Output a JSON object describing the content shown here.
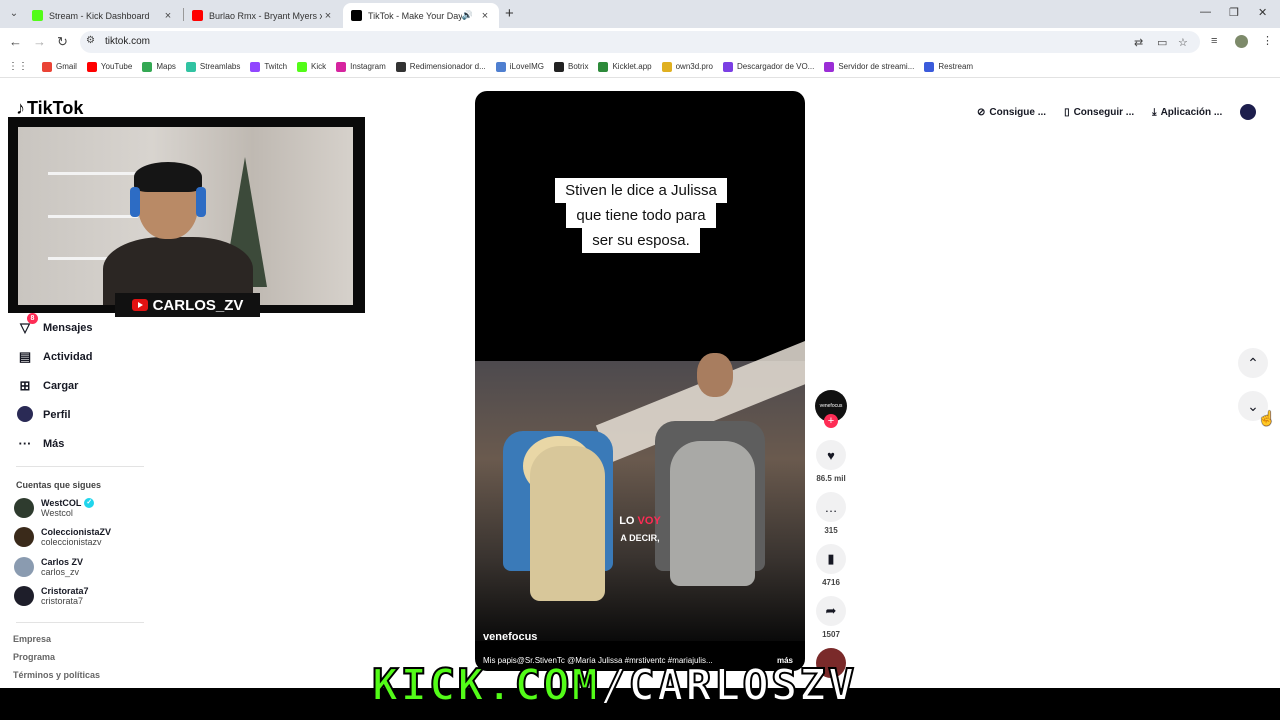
{
  "browser": {
    "tabs": [
      {
        "title": "Stream - Kick Dashboard",
        "color": "#53fc18"
      },
      {
        "title": "Burlao Rmx - Bryant Myers x An",
        "color": "#ff0000"
      },
      {
        "title": "TikTok - Make Your Day",
        "color": "#000000"
      }
    ],
    "url": "tiktok.com",
    "bookmarks": [
      {
        "label": "Gmail",
        "color": "#ea4335"
      },
      {
        "label": "YouTube",
        "color": "#ff0000"
      },
      {
        "label": "Maps",
        "color": "#34a853"
      },
      {
        "label": "Streamlabs",
        "color": "#31c3a2"
      },
      {
        "label": "Twitch",
        "color": "#9146ff"
      },
      {
        "label": "Kick",
        "color": "#53fc18"
      },
      {
        "label": "Instagram",
        "color": "#d6249f"
      },
      {
        "label": "Redimensionador d...",
        "color": "#333333"
      },
      {
        "label": "iLoveIMG",
        "color": "#4f7fd0"
      },
      {
        "label": "Botrix",
        "color": "#222222"
      },
      {
        "label": "Kicklet.app",
        "color": "#2d8a3a"
      },
      {
        "label": "own3d.pro",
        "color": "#e0b020"
      },
      {
        "label": "Descargador de VO...",
        "color": "#7b3fe4"
      },
      {
        "label": "Servidor de streami...",
        "color": "#9b2dd6"
      },
      {
        "label": "Restream",
        "color": "#3b5bdb"
      }
    ]
  },
  "tiktok": {
    "logo": "TikTok",
    "nav": [
      {
        "label": "Mensajes",
        "icon": "send-icon",
        "badge": "8"
      },
      {
        "label": "Actividad",
        "icon": "activity-icon"
      },
      {
        "label": "Cargar",
        "icon": "upload-icon"
      },
      {
        "label": "Perfil",
        "icon": "profile-avatar"
      },
      {
        "label": "Más",
        "icon": "more-icon"
      }
    ],
    "following_title": "Cuentas que sigues",
    "following": [
      {
        "name": "WestCOL",
        "user": "Westcol",
        "verified": true,
        "color": "#2e3b2e"
      },
      {
        "name": "ColeccionistaZV",
        "user": "coleccionistazv",
        "verified": false,
        "color": "#3a2a1a"
      },
      {
        "name": "Carlos ZV",
        "user": "carlos_zv",
        "verified": false,
        "color": "#8a9bb0"
      },
      {
        "name": "Cristorata7",
        "user": "cristorata7",
        "verified": false,
        "color": "#1e1e2a"
      }
    ],
    "footer": [
      "Empresa",
      "Programa",
      "Términos y políticas"
    ],
    "topright": [
      {
        "label": "Consigue ...",
        "icon": "coin-icon"
      },
      {
        "label": "Conseguir ...",
        "icon": "phone-icon"
      },
      {
        "label": "Aplicación ...",
        "icon": "download-icon"
      }
    ],
    "video": {
      "caption": [
        "Stiven le dice a Julissa",
        "que tiene todo para",
        "ser su esposa."
      ],
      "subtitle_a": "LO",
      "subtitle_b": "VOY",
      "subtitle_line2": "A DECIR,",
      "author": "venefocus",
      "description": "Mis papis@Sr.StivenTc @María Julissa #mrstiventc #mariajulis...",
      "more": "más"
    },
    "actions": {
      "author_avatar": "venefocus",
      "likes": "86.5 mil",
      "comments": "315",
      "saves": "4716",
      "shares": "1507"
    }
  },
  "overlay": {
    "streamer_name": "CARLOS_ZV",
    "kick_green": "KICK.COM",
    "kick_white": "/CARLOSZV"
  }
}
